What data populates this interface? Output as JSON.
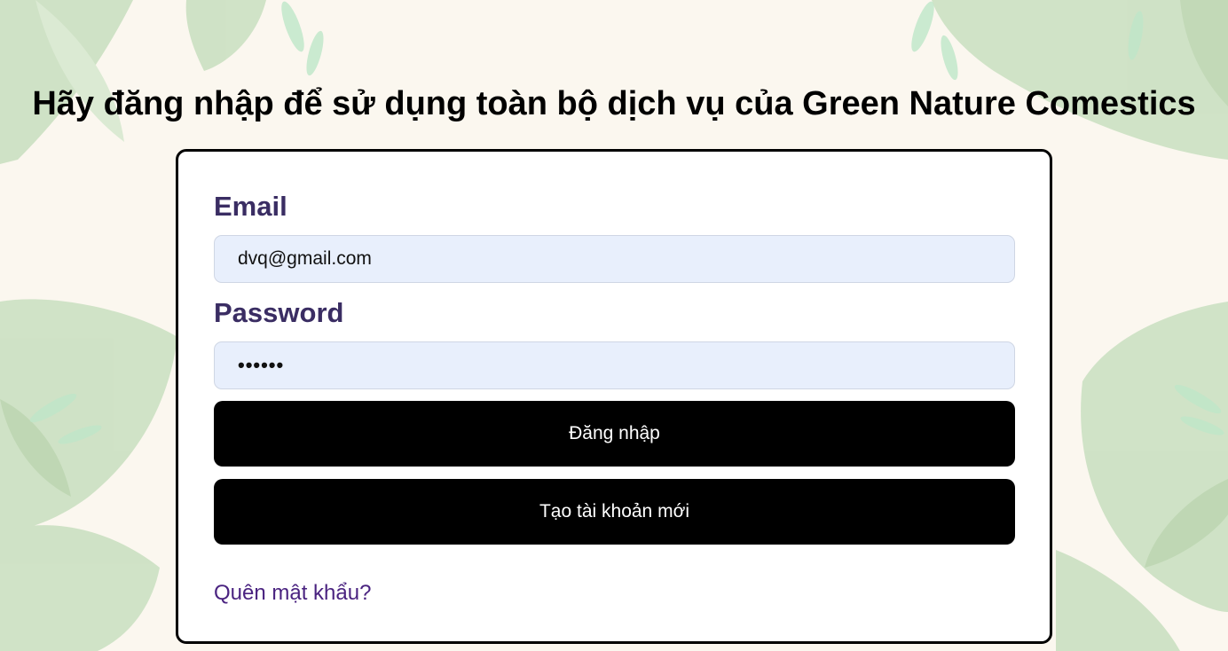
{
  "page": {
    "title": "Hãy đăng nhập để sử dụng toàn bộ dịch vụ của Green Nature Comestics"
  },
  "form": {
    "email_label": "Email",
    "email_value": "dvq@gmail.com",
    "password_label": "Password",
    "password_value": "••••••",
    "login_button": "Đăng nhập",
    "register_button": "Tạo tài khoản mới",
    "forgot_link": "Quên mật khẩu?"
  },
  "colors": {
    "background": "#fbf7ef",
    "leaf": "#c9dfc0",
    "label": "#3a2d63",
    "input_bg": "#e8effc",
    "button_bg": "#000000",
    "link": "#4a2380"
  }
}
